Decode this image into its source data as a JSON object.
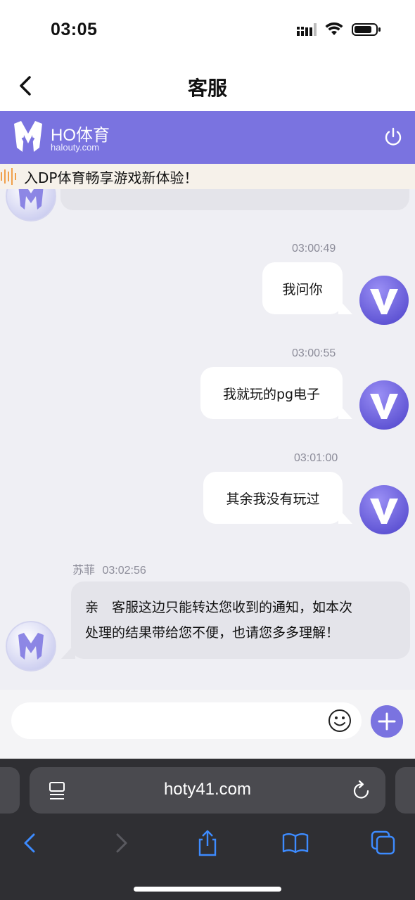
{
  "status_bar": {
    "time": "03:05"
  },
  "nav": {
    "title": "客服"
  },
  "brand": {
    "name": "HO体育",
    "domain": "halouty.com",
    "color": "#7a73e0"
  },
  "marquee": {
    "text": "入DP体育畅享游戏新体验！"
  },
  "messages": [
    {
      "sender": "me",
      "time": "03:00:49",
      "text": "我问你"
    },
    {
      "sender": "me",
      "time": "03:00:55",
      "text": "我就玩的pg电子"
    },
    {
      "sender": "me",
      "time": "03:01:00",
      "text": "其余我没有玩过"
    },
    {
      "sender": "agent",
      "name": "苏菲",
      "time": "03:02:56",
      "text_line1": "亲　客服这边只能转达您收到的通知，如本次",
      "text_line2": "处理的结果带给您不便，也请您多多理解！"
    }
  ],
  "input": {
    "placeholder": ""
  },
  "browser": {
    "url": "hoty41.com"
  },
  "icons": {
    "emoji": "smiley-icon",
    "add": "plus-icon",
    "back": "chevron-left-icon",
    "power": "power-icon"
  }
}
